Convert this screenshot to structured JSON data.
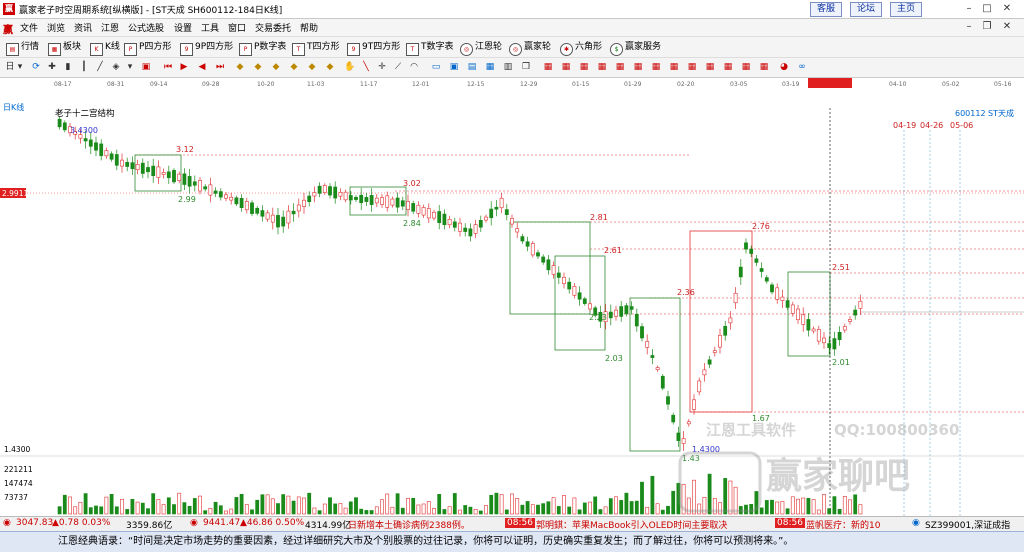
{
  "window": {
    "title": "赢家老子时空周期系统[纵横版] - [ST天成  SH600112-184日K线]",
    "links": [
      "客服",
      "论坛",
      "主页"
    ]
  },
  "menu": [
    "文件",
    "浏览",
    "资讯",
    "江恩",
    "公式选股",
    "设置",
    "工具",
    "窗口",
    "交易委托",
    "帮助"
  ],
  "toolbar": [
    "行情",
    "板块",
    "K线",
    "P四方形",
    "9P四方形",
    "P数字表",
    "T四方形",
    "9T四方形",
    "T数字表",
    "江恩轮",
    "赢家轮",
    "六角形",
    "赢家服务"
  ],
  "chart": {
    "period_label": "日K线",
    "indicator_title": "老子十二宫结构",
    "dates": [
      "08-17",
      "08-31",
      "09-14",
      "09-28",
      "10-20",
      "11-03",
      "11-17",
      "12-01",
      "12-15",
      "12-29",
      "01-15",
      "01-29",
      "02-20",
      "03-05",
      "03-19",
      "2024-03-28",
      "04-10",
      "05-02",
      "05-16"
    ],
    "stock_code": "600112",
    "stock_name": "ST天成",
    "future_dates": [
      "04-19",
      "04-26",
      "05-06"
    ],
    "price_labels": [
      "3.4300",
      "3.12",
      "2.99",
      "3.02",
      "2.84",
      "2.81",
      "2.61",
      "2.76",
      "2.36",
      "2.51",
      "2.23",
      "2.03",
      "2.01",
      "1.67",
      "1.4300",
      "1.43"
    ],
    "left_price_tag": "2.9911",
    "left_axis": [
      "1.4300",
      "221211",
      "147474",
      "73737"
    ],
    "watermark": {
      "brand": "江恩工具软件",
      "qq": "QQ:100800360",
      "logo": "赢家聊吧"
    }
  },
  "status": {
    "sh_index": "3047.83",
    "sh_change": "▲0.78 0.03%",
    "sh_amount": "3359.86亿",
    "sz_index": "9441.47",
    "sz_change": "▲46.86 0.50%",
    "sz_amount": "4314.99亿",
    "news": "日新增本土确诊病例2388例。",
    "time1": "08:56",
    "news2": "郭明錤：苹果MacBook引入OLED时间主要取决",
    "time2": "08:56",
    "news3": "蓝帆医疗：新的10",
    "right_code": "SZ399001,深证成指"
  },
  "quote": "江恩经典语录：“时间是决定市场走势的重要因素，经过详细研究大市及个别股票的过往记录，你将可以证明，历史确实重复发生；而了解过往，你将可以预测将来。”。"
}
